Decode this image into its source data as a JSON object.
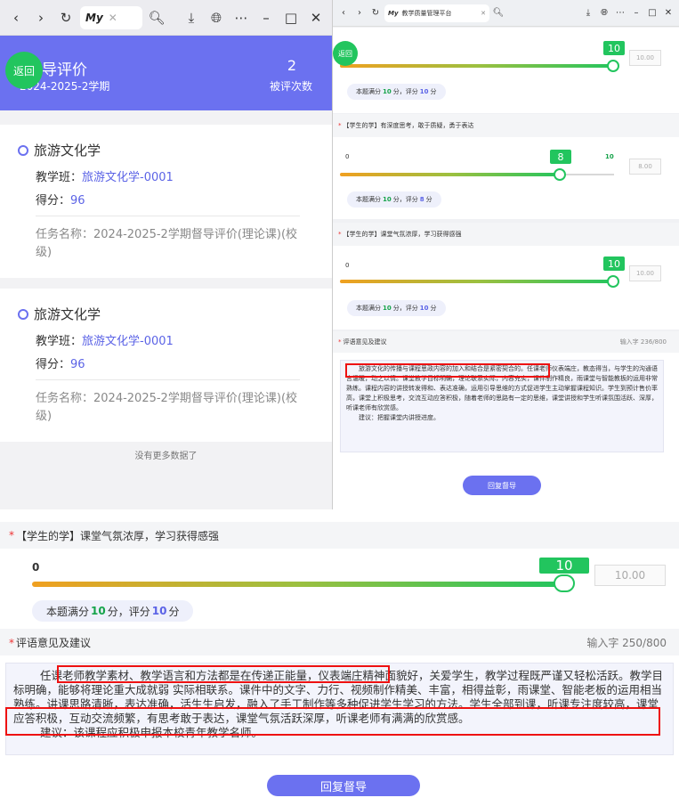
{
  "left": {
    "browser": {
      "tab_logo": "My"
    },
    "header": {
      "title": "督导评价",
      "term": "2024-2025-2学期",
      "count": "2",
      "count_label": "被评次数",
      "back_label": "返回"
    },
    "records": [
      {
        "course": "旅游文化学",
        "class_label": "教学班：",
        "class_value": "旅游文化学-0001",
        "score_label": "得分：",
        "score_value": "96",
        "task": "任务名称：2024-2025-2学期督导评价(理论课)(校级)"
      },
      {
        "course": "旅游文化学",
        "class_label": "教学班：",
        "class_value": "旅游文化学-0001",
        "score_label": "得分：",
        "score_value": "96",
        "task": "任务名称：2024-2025-2学期督导评价(理论课)(校级)"
      }
    ],
    "no_more": "没有更多数据了"
  },
  "right": {
    "browser": {
      "tab_logo": "My",
      "tab_title": "教学质量管理平台"
    },
    "back_label": "返回",
    "q1": {
      "min": "",
      "value": "10",
      "score_box": "10.00",
      "full_prefix": "本题满分",
      "full": "10",
      "unit1": "分，评分",
      "score": "10",
      "unit2": "分"
    },
    "q2": {
      "label": "【学生的学】有深度思考，敢于质疑，勇于表达",
      "min": "0",
      "max": "10",
      "value": "8",
      "score_box": "8.00",
      "full_prefix": "本题满分",
      "full": "10",
      "unit1": "分，评分",
      "score": "8",
      "unit2": "分"
    },
    "q3": {
      "label": "【学生的学】课堂气氛浓厚，学习获得感强",
      "min": "0",
      "value": "10",
      "score_box": "10.00",
      "full_prefix": "本题满分",
      "full": "10",
      "unit1": "分，评分",
      "score": "10",
      "unit2": "分"
    },
    "comment": {
      "label": "评语意见及建议",
      "counter": "输入字 236/800",
      "text": "旅游文化的传播与课程思政内容的加入和结合是紧密契合的。任课老师仪表端庄，教态得当，与学生的沟通语言温暖，动之以情。课堂教学目标明确，理论联系实际，内容充实，课件制作精良，雨课堂与智能教板的运用非常熟练。课程内容的讲授转发得和、表达准确，运用引导思维的方式促进学生主动掌握课程知识。学生到预计售价率高，课堂上积极思考，交流互动应答积极，随着老师的思路有一定的思维，课堂讲授和学生听课氛围活跃、深厚，听课老师有欣赏感。",
      "suggestion": "建议：把握课堂内讲授进度。"
    },
    "reply": "回复督导"
  },
  "bottom": {
    "q": {
      "label": "【学生的学】课堂气氛浓厚，学习获得感强",
      "min": "0",
      "value": "10",
      "score_box": "10.00",
      "full_prefix": "本题满分",
      "full": "10",
      "unit1": "分，评分",
      "score": "10",
      "unit2": "分"
    },
    "comment": {
      "label": "评语意见及建议",
      "counter": "输入字 250/800",
      "text": "任课老师教学素材、教学语言和方法都是在传递正能量，仪表端庄精神面貌好，关爱学生，教学过程既严谨又轻松活跃。教学目标明确，能够将理论重大成就弱 实际相联系。课件中的文字、力行、视频制作精美、丰富，相得益彰，雨课堂、智能老板的运用相当熟练。讲课思路清晰，表达准确，活生生启发，融入了手工制作等多种促进学生学习的方法。学生全部到课，听课专注度较高，课堂应答积极，互动交流频繁，有思考敢于表达，课堂气氛活跃深厚，听课老师有满满的欣赏感。",
      "suggestion": "建议：该课程应积极申报本校青年教学名师。"
    },
    "reply": "回复督导"
  },
  "colors": {
    "accent": "#6b71f0",
    "green": "#22c55e",
    "highlight": "#e11111"
  }
}
